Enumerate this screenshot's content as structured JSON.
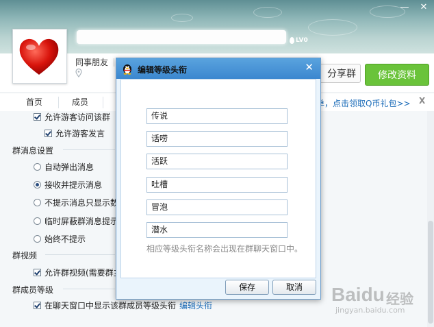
{
  "window": {
    "minimize": "—",
    "close": "✕"
  },
  "header": {
    "level_badge": "LV0"
  },
  "profile": {
    "friends_label": "同事朋友",
    "share_button": "分享群",
    "edit_button": "修改资料"
  },
  "tabs": [
    {
      "label": "首页"
    },
    {
      "label": "成员"
    }
  ],
  "promo": {
    "text": "单，点击领取Q币礼包>>",
    "close": "X"
  },
  "settings": {
    "allow_visitors": "允许游客访问该群",
    "allow_visitor_speak": "允许游客发言",
    "msg_section": "群消息设置",
    "msg_options": [
      {
        "label": "自动弹出消息",
        "checked": false
      },
      {
        "label": "接收并提示消息",
        "checked": true
      },
      {
        "label": "不提示消息只显示数",
        "checked": false
      },
      {
        "label": "临时屏蔽群消息提示",
        "checked": false
      },
      {
        "label": "始终不提示",
        "checked": false
      }
    ],
    "video_section": "群视频",
    "allow_video": "允许群视频(需要群主",
    "level_section": "群成员等级",
    "show_level": "在聊天窗口中显示该群成员等级头衔",
    "edit_title_link": "编辑头衔"
  },
  "dialog": {
    "title": "编辑等级头衔",
    "close": "✕",
    "titles": [
      {
        "value": "传说"
      },
      {
        "value": "话唠"
      },
      {
        "value": "活跃"
      },
      {
        "value": "吐槽"
      },
      {
        "value": "冒泡"
      },
      {
        "value": "潜水"
      }
    ],
    "hint": "相应等级头衔名称会出现在群聊天窗口中。",
    "save": "保存",
    "cancel": "取消"
  },
  "watermark": {
    "brand": "Baidu",
    "cn": "经验",
    "url": "jingyan.baidu.com"
  },
  "colors": {
    "accent_green": "#6ac33a",
    "dialog_title": "#3b87cf",
    "link": "#1a6bb8"
  }
}
